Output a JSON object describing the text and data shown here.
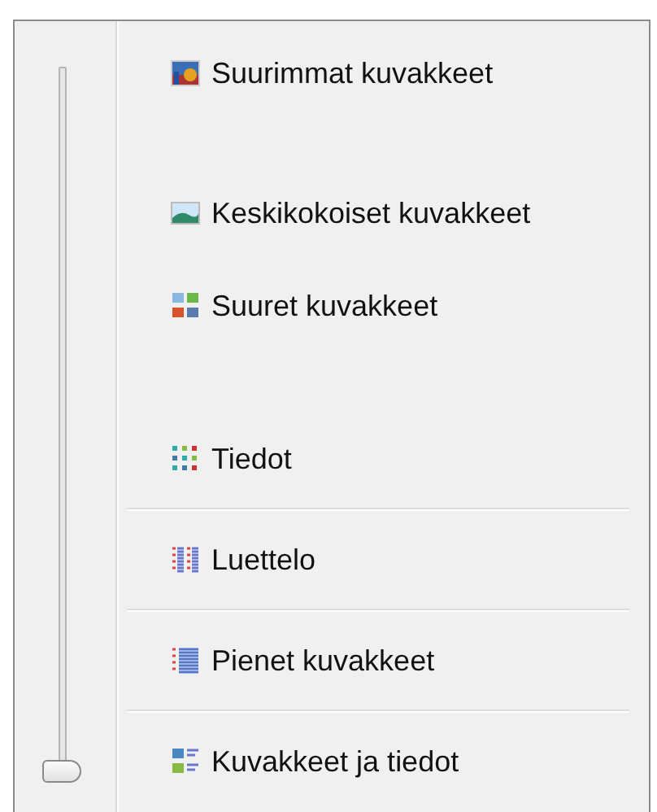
{
  "slider": {
    "level": 0
  },
  "items": [
    {
      "label": "Suurimmat kuvakkeet",
      "divider_above": false
    },
    {
      "label": "Keskikokoiset kuvakkeet",
      "divider_above": false
    },
    {
      "label": "Suuret kuvakkeet",
      "divider_above": false
    },
    {
      "label": "Tiedot",
      "divider_above": false
    },
    {
      "label": "Luettelo",
      "divider_above": true
    },
    {
      "label": "Pienet kuvakkeet",
      "divider_above": true
    },
    {
      "label": "Kuvakkeet ja tiedot",
      "divider_above": true
    }
  ]
}
